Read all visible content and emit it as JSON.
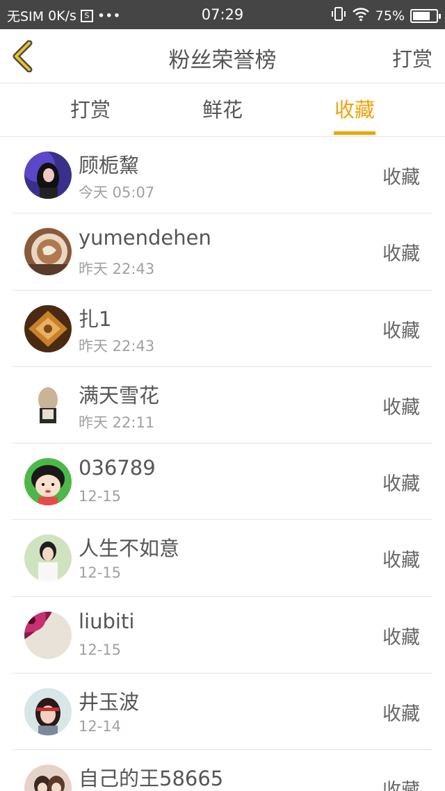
{
  "status_bar": {
    "carrier": "无SIM",
    "speed": "0K/s",
    "sim_icon": "S",
    "dots": "•••",
    "time": "07:29",
    "battery_text": "75%",
    "battery_level": 0.75,
    "icons": [
      "vibrate-icon",
      "wifi-icon",
      "battery-icon"
    ]
  },
  "header": {
    "title": "粉丝荣誉榜",
    "right_action": "打赏",
    "back_icon": "chevron-left-icon",
    "accent_color": "#f0a30a"
  },
  "tabs": [
    {
      "label": "打赏",
      "active": false
    },
    {
      "label": "鲜花",
      "active": false
    },
    {
      "label": "收藏",
      "active": true
    }
  ],
  "list": [
    {
      "name": "顾栀黧",
      "time": "今天 05:07",
      "action": "收藏"
    },
    {
      "name": "yumendehen",
      "time": "昨天 22:43",
      "action": "收藏"
    },
    {
      "name": "扎1",
      "time": "昨天 22:43",
      "action": "收藏"
    },
    {
      "name": "满天雪花",
      "time": "昨天 22:11",
      "action": "收藏"
    },
    {
      "name": "036789",
      "time": "12-15",
      "action": "收藏"
    },
    {
      "name": "人生不如意",
      "time": "12-15",
      "action": "收藏"
    },
    {
      "name": "liubiti",
      "time": "12-15",
      "action": "收藏"
    },
    {
      "name": "井玉波",
      "time": "12-14",
      "action": "收藏"
    },
    {
      "name": "自己的王58665",
      "time": "",
      "action": "收藏"
    }
  ]
}
